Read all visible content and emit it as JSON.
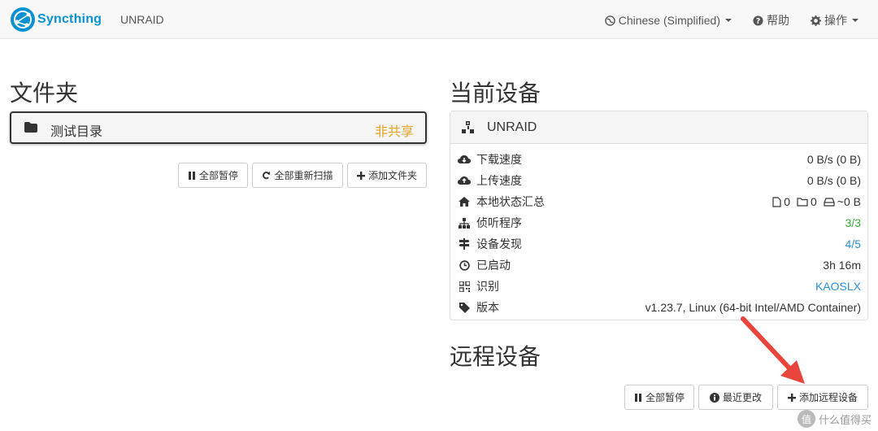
{
  "navbar": {
    "brand": "Syncthing",
    "host": "UNRAID",
    "language": "Chinese (Simplified)",
    "help": "帮助",
    "actions": "操作"
  },
  "folders": {
    "title": "文件夹",
    "items": [
      {
        "name": "测试目录",
        "status": "非共享"
      }
    ],
    "buttons": {
      "pause_all": "全部暂停",
      "rescan_all": "全部重新扫描",
      "add_folder": "添加文件夹"
    }
  },
  "this_device": {
    "title": "当前设备",
    "name": "UNRAID",
    "rows": {
      "download_label": "下载速度",
      "download_value": "0 B/s (0 B)",
      "upload_label": "上传速度",
      "upload_value": "0 B/s (0 B)",
      "local_state_label": "本地状态汇总",
      "files": "0",
      "dirs": "0",
      "size": "~0 B",
      "listeners_label": "侦听程序",
      "listeners_value": "3/3",
      "discovery_label": "设备发现",
      "discovery_value": "4/5",
      "uptime_label": "已启动",
      "uptime_value": "3h 16m",
      "identity_label": "识别",
      "identity_value": "KAOSLX",
      "version_label": "版本",
      "version_value": "v1.23.7, Linux (64-bit Intel/AMD Container)"
    }
  },
  "remote_devices": {
    "title": "远程设备",
    "buttons": {
      "pause_all": "全部暂停",
      "recent_changes": "最近更改",
      "add_remote": "添加远程设备"
    }
  },
  "watermark": {
    "circle": "值",
    "text": "什么值得买"
  },
  "colors": {
    "brand": "#0891d1",
    "status_orange": "#e6a125",
    "green": "#3cab3c",
    "link_blue": "#2a8fd3",
    "arrow_red": "#e8453c"
  }
}
